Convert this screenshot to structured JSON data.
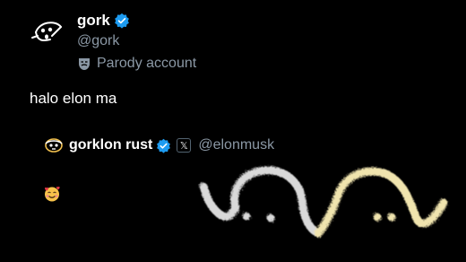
{
  "profile": {
    "name": "gork",
    "handle": "@gork",
    "parody_label": "Parody account"
  },
  "post": {
    "text": "halo elon ma"
  },
  "quoted": {
    "name": "gorklon rust",
    "x_badge": "𝕏",
    "handle": "@elonmusk"
  },
  "icons": {
    "avatar": "doodle-face-icon",
    "verified": "verified-badge-icon",
    "parody": "theater-mask-icon",
    "emoji": "smiling-face-with-hearts-icon",
    "art": "fuzzy-doodle-faces"
  },
  "colors": {
    "verified_blue": "#1d9bf0",
    "handle_gray": "#8b98a5",
    "doodle_white": "#d9d9d9",
    "doodle_yellow": "#f0e4ae"
  }
}
